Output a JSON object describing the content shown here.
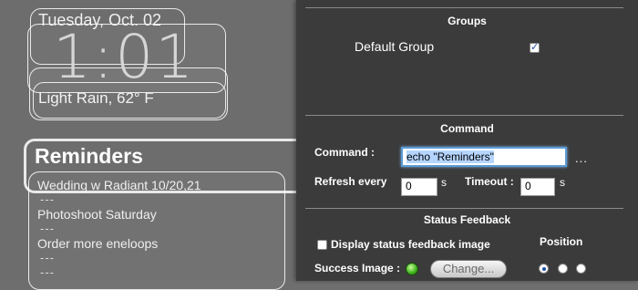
{
  "widgets": {
    "date": "Tuesday, Oct. 02",
    "time": "1:01",
    "weather": "Light Rain, 62° F",
    "reminders": {
      "title": "Reminders",
      "items": [
        "Wedding w Radiant 10/20,21",
        "Photoshoot Saturday",
        "Order more eneloops"
      ],
      "separator": "---"
    }
  },
  "panel": {
    "groups": {
      "heading": "Groups",
      "default_group_label": "Default Group",
      "default_group_checked": true
    },
    "command": {
      "heading": "Command",
      "command_label": "Command :",
      "command_value": "echo \"Reminders\"",
      "more_label": "...",
      "refresh_label": "Refresh every",
      "refresh_value": "0",
      "refresh_unit": "s",
      "timeout_label": "Timeout :",
      "timeout_value": "0",
      "timeout_unit": "s"
    },
    "status": {
      "heading": "Status Feedback",
      "display_label": "Display status feedback image",
      "display_checked": false,
      "position_label": "Position",
      "success_label": "Success Image :",
      "success_color": "#3bb019",
      "change_label": "Change...",
      "position_selected": 0
    }
  }
}
